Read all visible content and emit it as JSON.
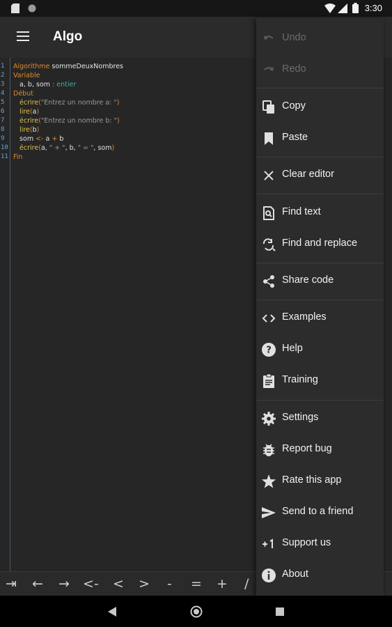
{
  "status": {
    "time": "3:30"
  },
  "appbar": {
    "title": "Algo"
  },
  "editor": {
    "line_numbers": [
      "1",
      "2",
      "3",
      "4",
      "5",
      "6",
      "7",
      "8",
      "9",
      "10",
      "11"
    ],
    "lines": [
      [
        {
          "t": "Algorithme ",
          "c": "kw"
        },
        {
          "t": "sommeDeuxNombres",
          "c": "id"
        }
      ],
      [
        {
          "t": "Variable",
          "c": "kw"
        }
      ],
      [
        {
          "t": "   a, b, som",
          "c": "id"
        },
        {
          "t": " : ",
          "c": "op"
        },
        {
          "t": "entier",
          "c": "ty"
        }
      ],
      [
        {
          "t": "Début",
          "c": "kw"
        }
      ],
      [
        {
          "t": "   écrire",
          "c": "fn"
        },
        {
          "t": "(",
          "c": "op"
        },
        {
          "t": "\"Entrez un nombre a: \"",
          "c": "str"
        },
        {
          "t": ")",
          "c": "op"
        }
      ],
      [
        {
          "t": "   lire",
          "c": "fn"
        },
        {
          "t": "(",
          "c": "op"
        },
        {
          "t": "a",
          "c": "id"
        },
        {
          "t": ")",
          "c": "op"
        }
      ],
      [
        {
          "t": "   écrire",
          "c": "fn"
        },
        {
          "t": "(",
          "c": "op"
        },
        {
          "t": "\"Entrez un nombre b: \"",
          "c": "str"
        },
        {
          "t": ")",
          "c": "op"
        }
      ],
      [
        {
          "t": "   lire",
          "c": "fn"
        },
        {
          "t": "(",
          "c": "op"
        },
        {
          "t": "b",
          "c": "id"
        },
        {
          "t": ")",
          "c": "op"
        }
      ],
      [
        {
          "t": "   som ",
          "c": "id"
        },
        {
          "t": "<- ",
          "c": "op"
        },
        {
          "t": "a ",
          "c": "id"
        },
        {
          "t": "+ ",
          "c": "op"
        },
        {
          "t": "b",
          "c": "id"
        }
      ],
      [
        {
          "t": "   écrire",
          "c": "fn"
        },
        {
          "t": "(",
          "c": "op"
        },
        {
          "t": "a, ",
          "c": "id"
        },
        {
          "t": "\" + \"",
          "c": "str"
        },
        {
          "t": ", b, ",
          "c": "id"
        },
        {
          "t": "\" = \"",
          "c": "str"
        },
        {
          "t": ", som",
          "c": "id"
        },
        {
          "t": ")",
          "c": "op"
        }
      ],
      [
        {
          "t": "Fin",
          "c": "kw"
        }
      ]
    ]
  },
  "toolbar": {
    "keys": [
      "⇥",
      "←",
      "→",
      "<-",
      "<",
      ">",
      "-",
      "=",
      "+",
      "/"
    ]
  },
  "menu": {
    "undo": "Undo",
    "redo": "Redo",
    "copy": "Copy",
    "paste": "Paste",
    "clear_editor": "Clear editor",
    "find_text": "Find text",
    "find_and_replace": "Find and replace",
    "share_code": "Share code",
    "examples": "Examples",
    "help": "Help",
    "training": "Training",
    "settings": "Settings",
    "report_bug": "Report bug",
    "rate_this_app": "Rate this app",
    "send_to_a_friend": "Send to a friend",
    "support_us": "Support us",
    "about": "About"
  },
  "colors": {
    "keyword": "#e08a2c",
    "type": "#2fb8a0",
    "function": "#e0c34c",
    "string": "#9a9a9a",
    "line_number": "#6aa3d8"
  }
}
